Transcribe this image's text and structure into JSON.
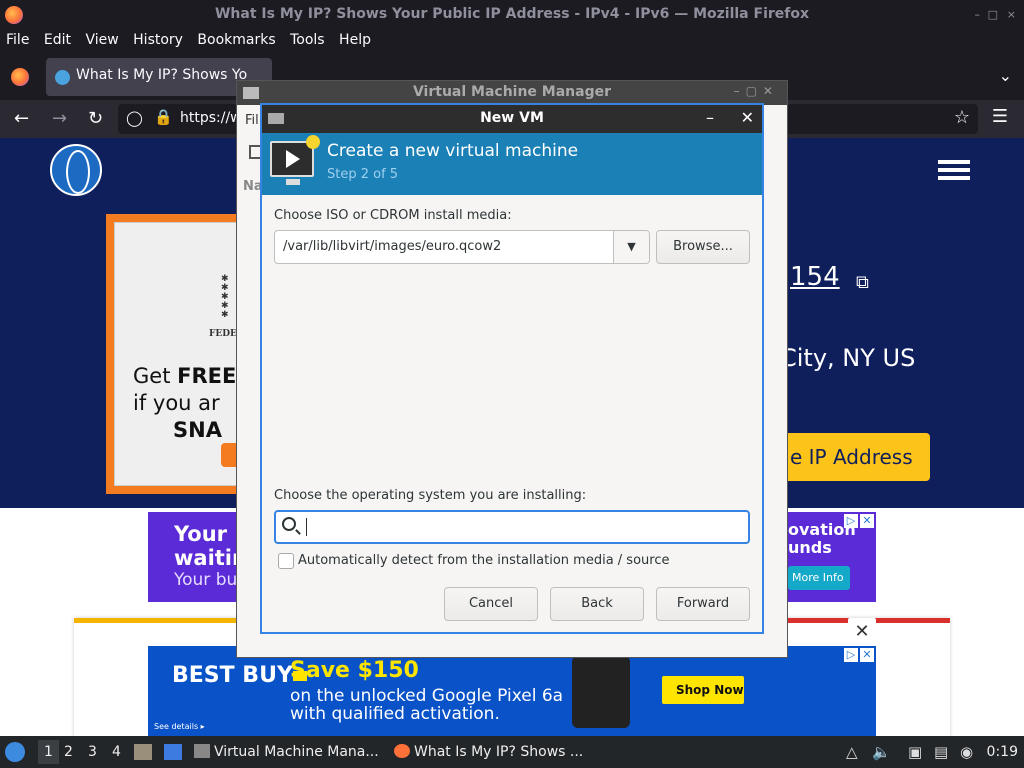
{
  "firefox": {
    "window_title": "What Is My IP? Shows Your Public IP Address - IPv4 - IPv6 — Mozilla Firefox",
    "menu": [
      "File",
      "Edit",
      "View",
      "History",
      "Bookmarks",
      "Tools",
      "Help"
    ],
    "tab_title": "What Is My IP? Shows Yo",
    "url": "https://w",
    "window_controls": [
      "–",
      "□",
      "×"
    ]
  },
  "webpage": {
    "ip_partial": "154",
    "location_partial": "City, NY US",
    "hide_button_partial": "e IP Address",
    "promo": {
      "headline": "Get FREE\nif you ar\nSNA",
      "federal": "FEDER"
    },
    "ad1": {
      "line1": "Your p",
      "line2": "waitir",
      "line3": "Your bu",
      "right1": "ovation",
      "right2": "unds",
      "more": "More Info"
    },
    "ad2": {
      "logo": "BEST BUY",
      "save": "Save $150",
      "sub1": "on the unlocked Google Pixel 6a",
      "sub2": "with qualified activation.",
      "shop": "Shop Now",
      "details": "See details ▸"
    }
  },
  "vmm": {
    "title": "Virtual Machine Manager",
    "file_menu": "Fil",
    "name_col": "Na"
  },
  "dialog": {
    "title": "New VM",
    "heading": "Create a new virtual machine",
    "step": "Step 2 of 5",
    "media_label": "Choose ISO or CDROM install media:",
    "media_value": "/var/lib/libvirt/images/euro.qcow2",
    "browse": "Browse...",
    "os_label": "Choose the operating system you are installing:",
    "os_search_value": "",
    "auto_detect_label": "Automatically detect from the installation media / source",
    "auto_detect_checked": false,
    "buttons": {
      "cancel": "Cancel",
      "back": "Back",
      "forward": "Forward"
    }
  },
  "taskbar": {
    "workspaces": [
      "1",
      "2",
      "3",
      "4"
    ],
    "tasks": [
      "Virtual Machine Mana...",
      "What Is My IP? Shows ..."
    ],
    "clock": "0:19"
  },
  "colors": {
    "dialog_banner": "#1a80b6",
    "focus_border": "#3584e4",
    "site_navy": "#0f1f5c",
    "hide_button": "#fcc419"
  }
}
